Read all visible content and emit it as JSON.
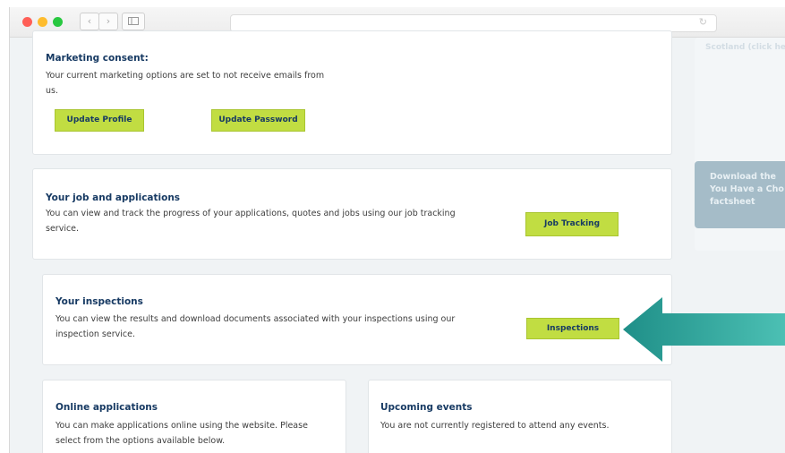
{
  "browser": {
    "back_icon": "chevron-left",
    "forward_icon": "chevron-right",
    "sidebar_icon": "sidebar-toggle",
    "reload_icon": "reload",
    "colors": {
      "close": "#ff5f57",
      "minimize": "#febc2e",
      "maximize": "#28c840"
    }
  },
  "marketing": {
    "title": "Marketing consent:",
    "text_line1": "Your current marketing options are set to not receive emails from",
    "text_line2": "us.",
    "update_profile": "Update Profile",
    "update_password": "Update Password"
  },
  "jobs": {
    "title": "Your job and applications",
    "text_line1": "You can view and track the progress of your applications, quotes and jobs using our job tracking",
    "text_line2": "service.",
    "button": "Job Tracking"
  },
  "inspections": {
    "title": "Your inspections",
    "text_line1": "You can view the results and download documents associated with your inspections using our",
    "text_line2": "inspection service.",
    "button": "Inspections"
  },
  "online": {
    "title": "Online applications",
    "text_line1": "You can make applications online using the website. Please",
    "text_line2": "select from the options available below."
  },
  "events": {
    "title": "Upcoming events",
    "text": "You are not currently registered to attend any events."
  },
  "sidebar": {
    "top_text": "Scotland (click he",
    "download_line1": "Download the",
    "download_line2": "You Have a Cho",
    "download_line3": "factsheet"
  },
  "arrow": {
    "color": "#2aa39a",
    "icon": "arrow-left"
  },
  "colors": {
    "accent": "#c1dd42",
    "heading": "#173a63"
  }
}
